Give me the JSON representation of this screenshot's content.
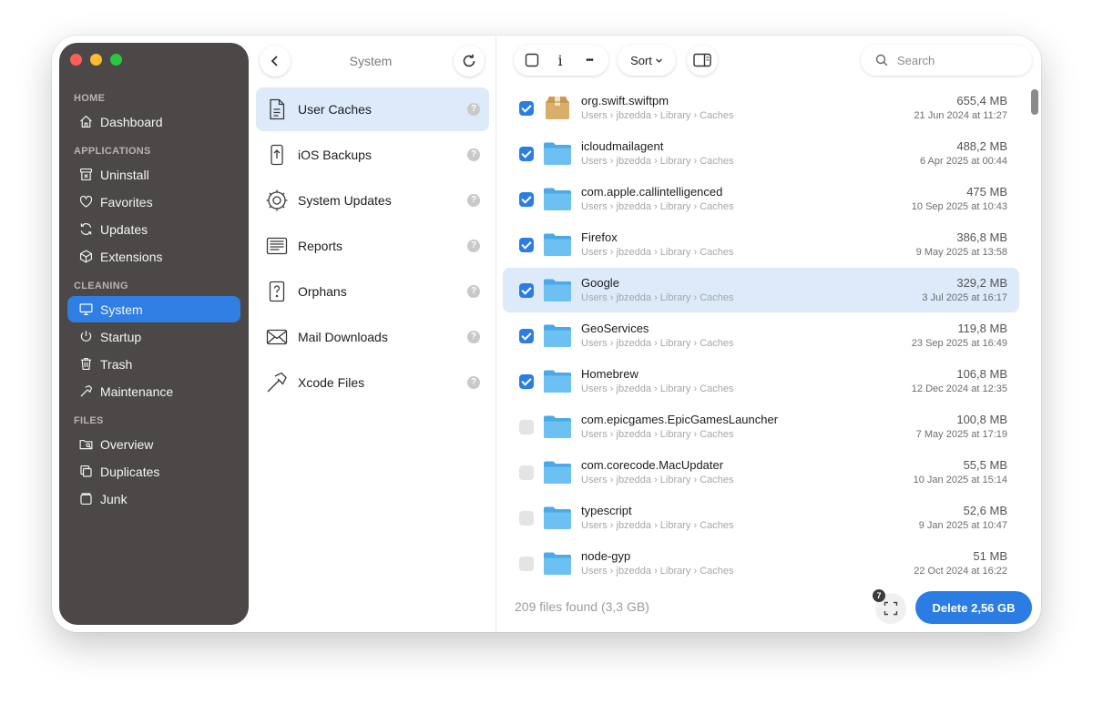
{
  "sidebar": {
    "sections": [
      {
        "title": "HOME",
        "items": [
          {
            "label": "Dashboard",
            "icon": "house-icon"
          }
        ]
      },
      {
        "title": "APPLICATIONS",
        "items": [
          {
            "label": "Uninstall",
            "icon": "uninstall-icon"
          },
          {
            "label": "Favorites",
            "icon": "heart-icon"
          },
          {
            "label": "Updates",
            "icon": "refresh-icon"
          },
          {
            "label": "Extensions",
            "icon": "cube-icon"
          }
        ]
      },
      {
        "title": "CLEANING",
        "items": [
          {
            "label": "System",
            "icon": "monitor-icon",
            "active": true
          },
          {
            "label": "Startup",
            "icon": "power-icon"
          },
          {
            "label": "Trash",
            "icon": "trash-icon"
          },
          {
            "label": "Maintenance",
            "icon": "hammer-icon"
          }
        ]
      },
      {
        "title": "FILES",
        "items": [
          {
            "label": "Overview",
            "icon": "folder-search-icon"
          },
          {
            "label": "Duplicates",
            "icon": "duplicate-icon"
          },
          {
            "label": "Junk",
            "icon": "junk-icon"
          }
        ]
      }
    ]
  },
  "middle": {
    "title": "System",
    "categories": [
      {
        "label": "User Caches",
        "icon": "document-icon",
        "active": true
      },
      {
        "label": "iOS Backups",
        "icon": "phone-backup-icon"
      },
      {
        "label": "System Updates",
        "icon": "gear-icon"
      },
      {
        "label": "Reports",
        "icon": "report-icon"
      },
      {
        "label": "Orphans",
        "icon": "question-document-icon"
      },
      {
        "label": "Mail Downloads",
        "icon": "envelope-icon"
      },
      {
        "label": "Xcode Files",
        "icon": "hammer-icon"
      }
    ],
    "help_glyph": "?"
  },
  "toolbar": {
    "info_label": "i",
    "more_label": "•••",
    "sort_label": "Sort",
    "search_placeholder": "Search"
  },
  "files": [
    {
      "name": "org.swift.swiftpm",
      "path": "Users › jbzedda › Library › Caches",
      "size": "655,4 MB",
      "date": "21 Jun 2024 at 11:27",
      "checked": true,
      "icon": "package-icon"
    },
    {
      "name": "icloudmailagent",
      "path": "Users › jbzedda › Library › Caches",
      "size": "488,2 MB",
      "date": "6 Apr 2025 at 00:44",
      "checked": true,
      "icon": "folder-icon"
    },
    {
      "name": "com.apple.callintelligenced",
      "path": "Users › jbzedda › Library › Caches",
      "size": "475 MB",
      "date": "10 Sep 2025 at 10:43",
      "checked": true,
      "icon": "folder-icon"
    },
    {
      "name": "Firefox",
      "path": "Users › jbzedda › Library › Caches",
      "size": "386,8 MB",
      "date": "9 May 2025 at 13:58",
      "checked": true,
      "icon": "folder-icon"
    },
    {
      "name": "Google",
      "path": "Users › jbzedda › Library › Caches",
      "size": "329,2 MB",
      "date": "3 Jul 2025 at 16:17",
      "checked": true,
      "icon": "folder-icon",
      "selected": true
    },
    {
      "name": "GeoServices",
      "path": "Users › jbzedda › Library › Caches",
      "size": "119,8 MB",
      "date": "23 Sep 2025 at 16:49",
      "checked": true,
      "icon": "folder-icon"
    },
    {
      "name": "Homebrew",
      "path": "Users › jbzedda › Library › Caches",
      "size": "106,8 MB",
      "date": "12 Dec 2024 at 12:35",
      "checked": true,
      "icon": "folder-icon"
    },
    {
      "name": "com.epicgames.EpicGamesLauncher",
      "path": "Users › jbzedda › Library › Caches",
      "size": "100,8 MB",
      "date": "7 May 2025 at 17:19",
      "checked": false,
      "icon": "folder-icon"
    },
    {
      "name": "com.corecode.MacUpdater",
      "path": "Users › jbzedda › Library › Caches",
      "size": "55,5 MB",
      "date": "10 Jan 2025 at 15:14",
      "checked": false,
      "icon": "folder-icon"
    },
    {
      "name": "typescript",
      "path": "Users › jbzedda › Library › Caches",
      "size": "52,6 MB",
      "date": "9 Jan 2025 at 10:47",
      "checked": false,
      "icon": "folder-icon"
    },
    {
      "name": "node-gyp",
      "path": "Users › jbzedda › Library › Caches",
      "size": "51 MB",
      "date": "22 Oct 2024 at 16:22",
      "checked": false,
      "icon": "folder-icon"
    }
  ],
  "footer": {
    "count_text": "209 files found (3,3 GB)",
    "expand_badge": "7",
    "delete_label": "Delete 2,56 GB"
  },
  "colors": {
    "accent": "#2b7de3",
    "sidebar_bg": "#4b4847",
    "selection_bg": "#dceafa",
    "folder": "#5bb5ef"
  }
}
